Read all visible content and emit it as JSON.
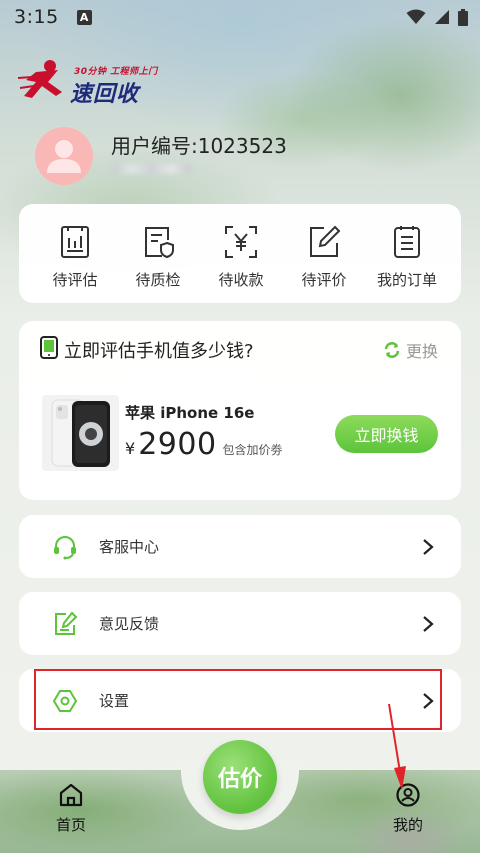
{
  "status_bar": {
    "time": "3:15",
    "notification_badge": "A"
  },
  "logo": {
    "tagline": "30分钟 工程师上门",
    "name": "速回收"
  },
  "user": {
    "id_label": "用户编号:1023523"
  },
  "orders": {
    "items": [
      {
        "label": "待评估",
        "icon": "clipboard-chart-icon"
      },
      {
        "label": "待质检",
        "icon": "shield-document-icon"
      },
      {
        "label": "待收款",
        "icon": "scan-yuan-icon"
      },
      {
        "label": "待评价",
        "icon": "edit-pen-icon"
      },
      {
        "label": "我的订单",
        "icon": "list-document-icon"
      }
    ]
  },
  "estimate": {
    "title": "立即评估手机值多少钱?",
    "swap_label": "更换",
    "phone_name": "苹果 iPhone 16e",
    "currency": "¥",
    "price": "2900",
    "price_note": "包含加价劵",
    "button_label": "立即换钱"
  },
  "menu": {
    "items": [
      {
        "label": "客服中心",
        "icon": "headset-icon"
      },
      {
        "label": "意见反馈",
        "icon": "feedback-edit-icon"
      },
      {
        "label": "设置",
        "icon": "hexagon-settings-icon"
      }
    ]
  },
  "nav": {
    "home_label": "首页",
    "center_label": "估价",
    "mine_label": "我的"
  },
  "colors": {
    "accent_green": "#5cc43a",
    "highlight_red": "#e0242a",
    "avatar_pink": "#f9b8b5"
  }
}
